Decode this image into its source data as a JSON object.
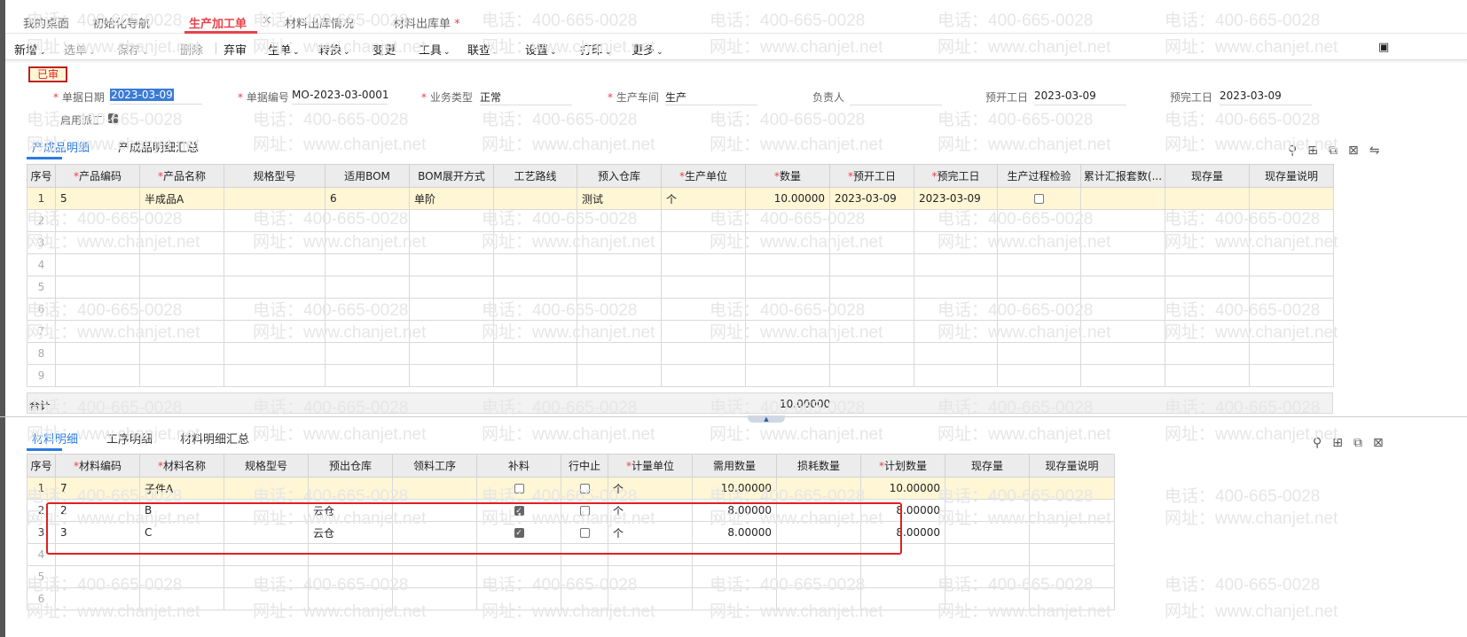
{
  "tabs": [
    {
      "label": "我的桌面"
    },
    {
      "label": "初始化导航"
    },
    {
      "label": "生产加工单",
      "active": true
    },
    {
      "label": "材料出库情况"
    },
    {
      "label": "材料出库单",
      "dirty": "*"
    }
  ],
  "tab_close": "×",
  "toolbar": [
    {
      "label": "新增",
      "chev": true
    },
    {
      "label": "选单",
      "chev": true,
      "disabled": true
    },
    {
      "label": "保存",
      "chev": true,
      "disabled": true
    },
    {
      "label": "删除",
      "disabled": true
    },
    {
      "label": "弃审"
    },
    {
      "label": "生单",
      "chev": true
    },
    {
      "label": "转换",
      "chev": true
    },
    {
      "label": "变更"
    },
    {
      "label": "工具",
      "chev": true
    },
    {
      "label": "联查",
      "chev": true
    },
    {
      "label": "设置",
      "chev": true
    },
    {
      "label": "打印",
      "chev": true
    },
    {
      "label": "更多",
      "chev": true
    }
  ],
  "chev": "⌄",
  "status_badge": "已审",
  "form": {
    "date_label": "单据日期",
    "date": "2023-03-09",
    "no_label": "单据编号",
    "no": "MO-2023-03-0001",
    "type_label": "业务类型",
    "type": "正常",
    "workshop_label": "生产车间",
    "workshop": "生产",
    "owner_label": "负责人",
    "owner": "",
    "start_label": "预开工日",
    "start": "2023-03-09",
    "end_label": "预完工日",
    "end": "2023-03-09",
    "dispatch_label": "启用派工",
    "dispatch_checked": true
  },
  "star": "*",
  "product_tabs": [
    "产成品明细",
    "产成品明细汇总"
  ],
  "product_table": {
    "columns": [
      {
        "t": "序号"
      },
      {
        "t": "产品编码",
        "req": 1
      },
      {
        "t": "产品名称",
        "req": 1
      },
      {
        "t": "规格型号"
      },
      {
        "t": "适用BOM"
      },
      {
        "t": "BOM展开方式"
      },
      {
        "t": "工艺路线"
      },
      {
        "t": "预入仓库"
      },
      {
        "t": "生产单位",
        "req": 1
      },
      {
        "t": "数量",
        "req": 1
      },
      {
        "t": "预开工日",
        "req": 1
      },
      {
        "t": "预完工日",
        "req": 1
      },
      {
        "t": "生产过程检验"
      },
      {
        "t": "累计汇报套数(..."
      },
      {
        "t": "现存量"
      },
      {
        "t": "现存量说明"
      }
    ],
    "rows": [
      [
        "1",
        "5",
        "半成品A",
        "",
        "6",
        "单阶",
        "",
        "测试",
        "个",
        "10.00000",
        "2023-03-09",
        "2023-03-09",
        "☐",
        "",
        "",
        ""
      ],
      [
        "2"
      ],
      [
        "3"
      ],
      [
        "4"
      ],
      [
        "5"
      ],
      [
        "6"
      ],
      [
        "7"
      ],
      [
        "8"
      ],
      [
        "9"
      ]
    ],
    "total_label": "合计",
    "total_qty": "10.00000"
  },
  "material_tabs": [
    "材料明细",
    "工序明细",
    "材料明细汇总"
  ],
  "material_table": {
    "columns": [
      {
        "t": "序号"
      },
      {
        "t": "材料编码",
        "req": 1
      },
      {
        "t": "材料名称",
        "req": 1
      },
      {
        "t": "规格型号"
      },
      {
        "t": "预出仓库"
      },
      {
        "t": "领料工序"
      },
      {
        "t": "补料"
      },
      {
        "t": "行中止"
      },
      {
        "t": "计量单位",
        "req": 1
      },
      {
        "t": "需用数量"
      },
      {
        "t": "损耗数量"
      },
      {
        "t": "计划数量",
        "req": 1
      },
      {
        "t": "现存量"
      },
      {
        "t": "现存量说明"
      }
    ],
    "rows": [
      [
        "1",
        "7",
        "子件A",
        "",
        "",
        "",
        "☐",
        "☐",
        "个",
        "10.00000",
        "",
        "10.00000",
        "",
        ""
      ],
      [
        "2",
        "2",
        "B",
        "",
        "云仓",
        "",
        "☑",
        "☐",
        "个",
        "8.00000",
        "",
        "8.00000",
        "",
        ""
      ],
      [
        "3",
        "3",
        "C",
        "",
        "云仓",
        "",
        "☑",
        "☐",
        "个",
        "8.00000",
        "",
        "8.00000",
        "",
        ""
      ],
      [
        "4"
      ],
      [
        "5"
      ],
      [
        "6"
      ]
    ]
  },
  "watermark": {
    "phone": "电话：400-665-0028",
    "url": "网址：www.chanjet.net"
  }
}
